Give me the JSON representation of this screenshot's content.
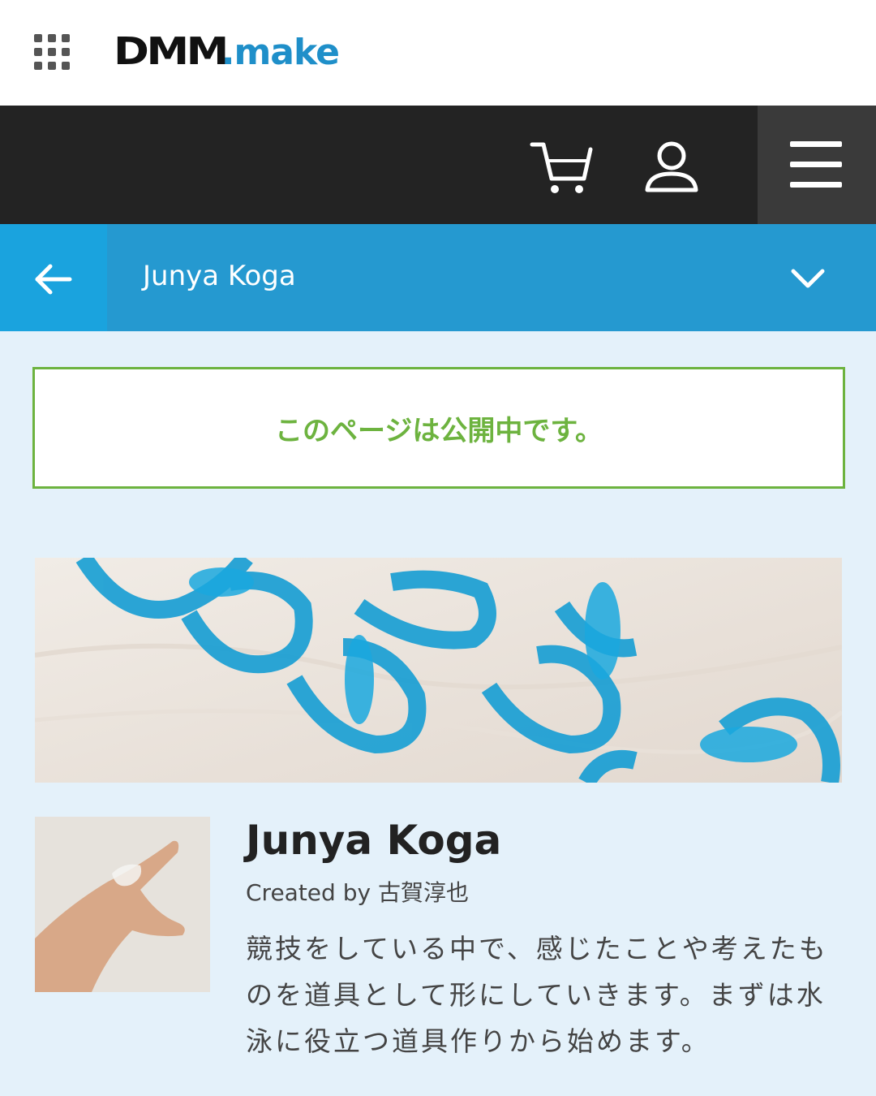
{
  "header": {
    "logo_dmm": "DMM",
    "logo_make": ".make",
    "apps_icon": "grid-icon"
  },
  "navbar": {
    "cart_icon": "cart-icon",
    "user_icon": "user-icon",
    "menu_icon": "hamburger-icon"
  },
  "titlebar": {
    "back_icon": "arrow-left-icon",
    "title": "Junya Koga",
    "dropdown_icon": "chevron-down-icon"
  },
  "status": {
    "message": "このページは公開中です。"
  },
  "profile": {
    "name": "Junya Koga",
    "created_by": "Created by 古賀淳也",
    "description": "競技をしている中で、感じたことや考えたものを道具として形にしていきます。まずは水泳に役立つ道具作りから始めます。"
  },
  "colors": {
    "accent_blue": "#2599d0",
    "back_blue": "#1aa3de",
    "status_green": "#6db33f",
    "nav_dark": "#232323",
    "page_bg": "#e4f1fa"
  }
}
